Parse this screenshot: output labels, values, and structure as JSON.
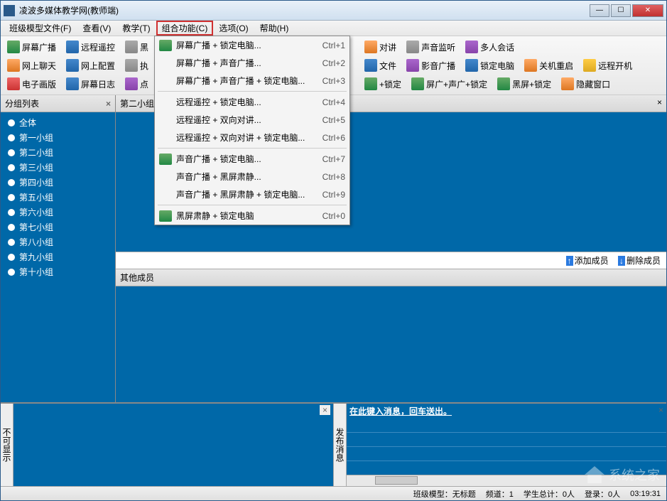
{
  "window": {
    "title": "凌波多媒体教学网(教师端)"
  },
  "menubar": [
    {
      "label": "班级模型文件(F)"
    },
    {
      "label": "查看(V)"
    },
    {
      "label": "教学(T)"
    },
    {
      "label": "组合功能(C)",
      "highlighted": true
    },
    {
      "label": "选项(O)"
    },
    {
      "label": "帮助(H)"
    }
  ],
  "toolbar_rows": [
    [
      {
        "label": "屏幕广播",
        "ico": "ico-green"
      },
      {
        "label": "远程遥控",
        "ico": "ico-blue"
      },
      {
        "label": "黑",
        "ico": "ico-gray",
        "clipped": true
      },
      {
        "label": "对讲",
        "ico": "ico-orange",
        "offset": true
      },
      {
        "label": "声音监听",
        "ico": "ico-gray"
      },
      {
        "label": "多人会话",
        "ico": "ico-purple"
      }
    ],
    [
      {
        "label": "网上聊天",
        "ico": "ico-orange"
      },
      {
        "label": "网上配置",
        "ico": "ico-blue"
      },
      {
        "label": "执",
        "ico": "ico-gray",
        "clipped": true
      },
      {
        "label": "文件",
        "ico": "ico-blue",
        "offset": true
      },
      {
        "label": "影音广播",
        "ico": "ico-purple"
      },
      {
        "label": "锁定电脑",
        "ico": "ico-blue"
      },
      {
        "label": "关机重启",
        "ico": "ico-orange"
      },
      {
        "label": "远程开机",
        "ico": "ico-yellow"
      }
    ],
    [
      {
        "label": "电子画版",
        "ico": "ico-red"
      },
      {
        "label": "屏幕日志",
        "ico": "ico-blue"
      },
      {
        "label": "点",
        "ico": "ico-purple",
        "clipped": true
      },
      {
        "label": "+锁定",
        "ico": "ico-green",
        "offset": true
      },
      {
        "label": "屏广+声广+锁定",
        "ico": "ico-green"
      },
      {
        "label": "黑屏+锁定",
        "ico": "ico-green"
      },
      {
        "label": "隐藏窗口",
        "ico": "ico-orange"
      }
    ]
  ],
  "sidebar": {
    "title": "分组列表",
    "items": [
      "全体",
      "第一小组",
      "第二小组",
      "第三小组",
      "第四小组",
      "第五小组",
      "第六小组",
      "第七小组",
      "第八小组",
      "第九小组",
      "第十小组"
    ]
  },
  "main": {
    "tab_label": "第二小组",
    "add_member": "添加成员",
    "del_member": "删除成员",
    "other_members": "其他成员"
  },
  "bottom": {
    "left_label": "不可显示",
    "right_label": "发布消息",
    "msg_prompt": "在此键入消息，回车送出。"
  },
  "status": {
    "model": "班级模型：无标题",
    "channel": "频道：1",
    "total": "学生总计：0人",
    "login": "登录：0人",
    "time": "03:19:31"
  },
  "dropdown": [
    {
      "label": "屏幕广播 + 锁定电脑...",
      "key": "Ctrl+1",
      "ico": "ico-green"
    },
    {
      "label": "屏幕广播 + 声音广播...",
      "key": "Ctrl+2"
    },
    {
      "label": "屏幕广播 + 声音广播 + 锁定电脑...",
      "key": "Ctrl+3"
    },
    {
      "sep": true
    },
    {
      "label": "远程遥控 + 锁定电脑...",
      "key": "Ctrl+4"
    },
    {
      "label": "远程遥控 + 双向对讲...",
      "key": "Ctrl+5"
    },
    {
      "label": "远程遥控 + 双向对讲 + 锁定电脑...",
      "key": "Ctrl+6"
    },
    {
      "sep": true
    },
    {
      "label": "声音广播 + 锁定电脑...",
      "key": "Ctrl+7",
      "ico": "ico-green"
    },
    {
      "label": "声音广播 + 黑屏肃静...",
      "key": "Ctrl+8"
    },
    {
      "label": "声音广播 + 黑屏肃静 + 锁定电脑...",
      "key": "Ctrl+9"
    },
    {
      "sep": true
    },
    {
      "label": "黑屏肃静 + 锁定电脑",
      "key": "Ctrl+0",
      "ico": "ico-green"
    }
  ],
  "watermark": "系统之家"
}
